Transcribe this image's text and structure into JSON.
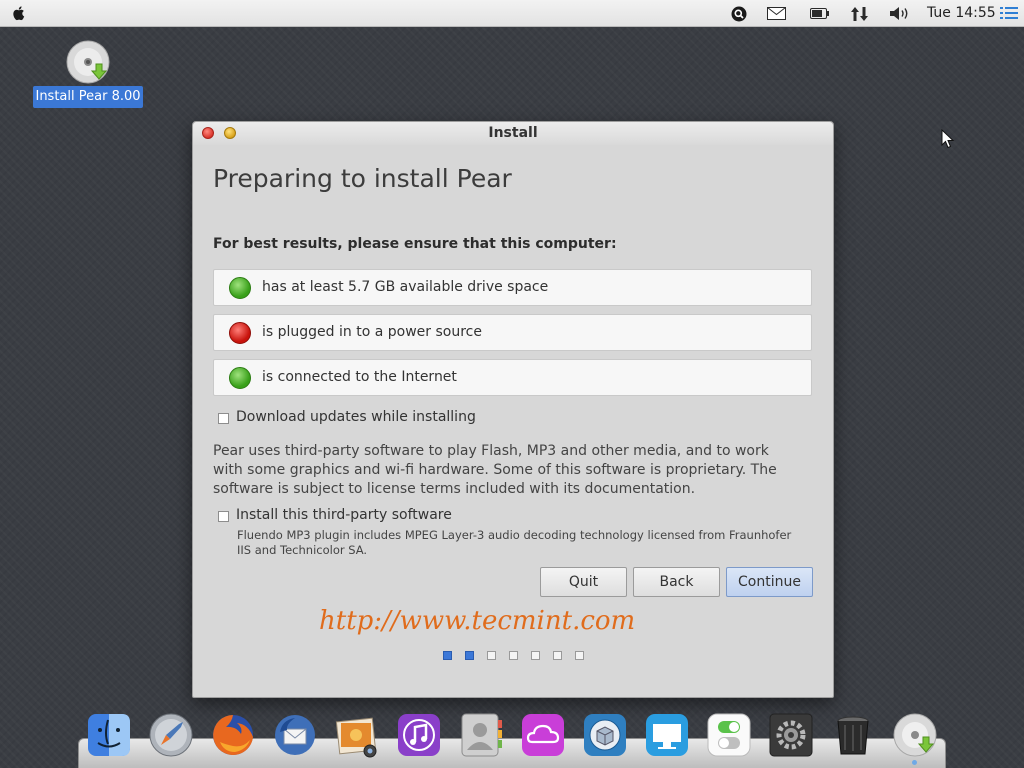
{
  "menubar": {
    "clock": "Tue 14:55",
    "icons": [
      "apple-icon",
      "search-icon",
      "mail-icon",
      "battery-icon",
      "network-icon",
      "volume-icon",
      "notifications-icon"
    ]
  },
  "desktop": {
    "icon_label": "Install Pear 8.00",
    "icon": "disc-install-icon"
  },
  "window": {
    "title": "Install",
    "heading": "Preparing to install Pear",
    "subheading": "For best results, please ensure that this computer:",
    "requirements": [
      {
        "text": "has at least 5.7 GB available drive space",
        "status": "ok",
        "color": "#3aa01b"
      },
      {
        "text": "is plugged in to a power source",
        "status": "fail",
        "color": "#c8130c"
      },
      {
        "text": "is connected to the Internet",
        "status": "ok",
        "color": "#3aa01b"
      }
    ],
    "download_updates_label": "Download updates while installing",
    "download_updates_checked": false,
    "third_party_paragraph": "Pear uses third-party software to play Flash, MP3 and other media, and to work with some graphics and wi-fi hardware. Some of this software is proprietary. The software is subject to license terms included with its documentation.",
    "third_party_label": "Install this third-party software",
    "third_party_checked": false,
    "third_party_note": "Fluendo MP3 plugin includes MPEG Layer-3 audio decoding technology licensed from Fraunhofer IIS and Technicolor SA.",
    "buttons": {
      "quit": "Quit",
      "back": "Back",
      "continue": "Continue"
    },
    "watermark": "http://www.tecmint.com",
    "steps": {
      "total": 7,
      "current": 2
    }
  },
  "dock": {
    "items": [
      "finder-icon",
      "launchpad-rocket-icon",
      "firefox-icon",
      "thunderbird-icon",
      "photos-icon",
      "music-icon",
      "contacts-icon",
      "cloud-icon",
      "software-center-icon",
      "display-icon",
      "settings-toggles-icon",
      "system-gear-icon",
      "trash-icon",
      "install-disc-icon"
    ]
  },
  "colors": {
    "accent": "#3c78d8",
    "watermark": "#e06c1c",
    "desktop": "#3a3d43"
  }
}
